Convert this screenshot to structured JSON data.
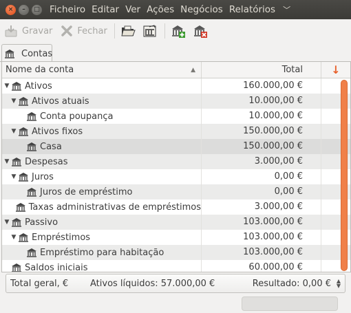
{
  "menu": {
    "items": [
      "Ficheiro",
      "Editar",
      "Ver",
      "Ações",
      "Negócios",
      "Relatórios"
    ],
    "more_icon": "chevron-down-icon"
  },
  "toolbar": {
    "save_label": "Gravar",
    "close_label": "Fechar"
  },
  "tab": {
    "label": "Contas"
  },
  "table": {
    "headers": {
      "name": "Nome da conta",
      "total": "Total"
    },
    "rows": [
      {
        "name": "Ativos",
        "total": "160.000,00 €",
        "level": 0,
        "expander": "▼"
      },
      {
        "name": "Ativos atuais",
        "total": "10.000,00 €",
        "level": 1,
        "expander": "▼"
      },
      {
        "name": "Conta poupança",
        "total": "10.000,00 €",
        "level": 2,
        "expander": ""
      },
      {
        "name": "Ativos fixos",
        "total": "150.000,00 €",
        "level": 1,
        "expander": "▼"
      },
      {
        "name": "Casa",
        "total": "150.000,00 €",
        "level": 2,
        "expander": ""
      },
      {
        "name": "Despesas",
        "total": "3.000,00 €",
        "level": 0,
        "expander": "▼"
      },
      {
        "name": "Juros",
        "total": "0,00 €",
        "level": 1,
        "expander": "▼"
      },
      {
        "name": "Juros de empréstimo",
        "total": "0,00 €",
        "level": 2,
        "expander": ""
      },
      {
        "name": "Taxas administrativas de empréstimos",
        "total": "3.000,00 €",
        "level": 1,
        "expander": ""
      },
      {
        "name": "Passivo",
        "total": "103.000,00 €",
        "level": 0,
        "expander": "▼"
      },
      {
        "name": "Empréstimos",
        "total": "103.000,00 €",
        "level": 1,
        "expander": "▼"
      },
      {
        "name": "Empréstimo para habitação",
        "total": "103.000,00 €",
        "level": 2,
        "expander": ""
      },
      {
        "name": "Saldos iniciais",
        "total": "60.000,00 €",
        "level": 0,
        "expander": ""
      }
    ]
  },
  "summary": {
    "total_label": "Total geral, €",
    "net_assets": "Ativos líquidos: 57.000,00 €",
    "result": "Resultado: 0,00 €"
  },
  "colors": {
    "accent": "#f08049",
    "titlebar": "#3c3b37",
    "close": "#df4a16"
  }
}
